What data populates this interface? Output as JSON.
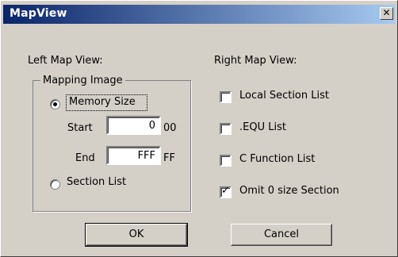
{
  "window": {
    "title": "MapView",
    "close_symbol": "✕"
  },
  "left": {
    "heading": "Left Map View:",
    "group_label": "Mapping Image",
    "memory_size": {
      "label": "Memory Size",
      "selected": true
    },
    "start": {
      "label": "Start",
      "value": "0",
      "suffix": "00"
    },
    "end": {
      "label": "End",
      "value": "FFF",
      "suffix": "FF"
    },
    "section_list": {
      "label": "Section List",
      "selected": false
    }
  },
  "right": {
    "heading": "Right Map View:",
    "options": [
      {
        "label": "Local Section List",
        "checked": false
      },
      {
        "label": ".EQU List",
        "checked": false
      },
      {
        "label": "C Function List",
        "checked": false
      },
      {
        "label": "Omit 0 size Section",
        "checked": true
      }
    ],
    "check_symbol": "✓"
  },
  "buttons": {
    "ok": "OK",
    "cancel": "Cancel"
  }
}
